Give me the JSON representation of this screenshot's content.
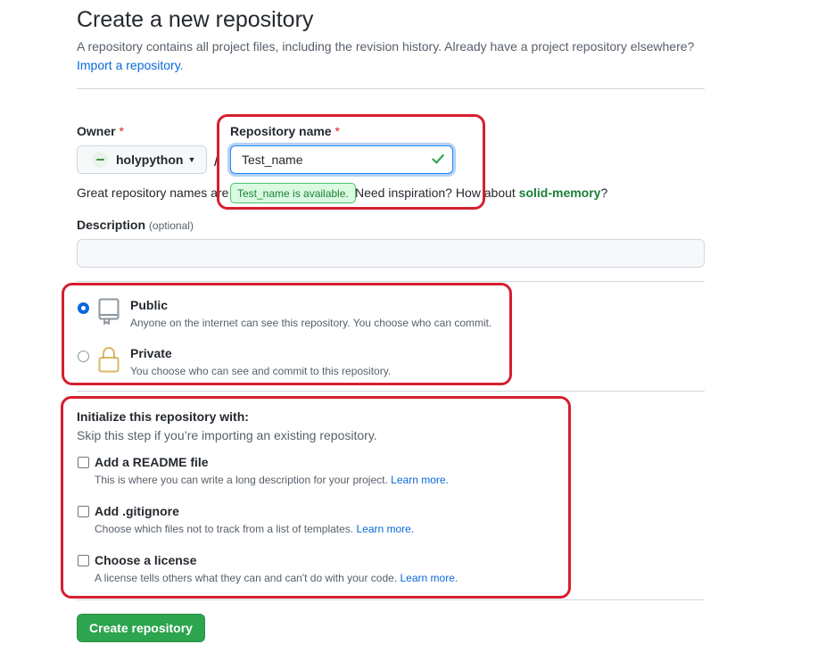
{
  "header": {
    "title": "Create a new repository",
    "subtitle": "A repository contains all project files, including the revision history. Already have a project repository elsewhere?",
    "import_link": "Import a repository."
  },
  "owner": {
    "label": "Owner",
    "required_mark": "*",
    "value": "holypython",
    "separator": "/"
  },
  "repo_name": {
    "label": "Repository name",
    "required_mark": "*",
    "value": "Test_name",
    "availability": "Test_name is available."
  },
  "naming_hint": {
    "prefix": "Great repository names are",
    "inspiration": "Need inspiration? How about",
    "suggestion": "solid-memory",
    "suffix": "?"
  },
  "description": {
    "label": "Description",
    "optional": "(optional)",
    "value": ""
  },
  "visibility": {
    "options": [
      {
        "title": "Public",
        "desc": "Anyone on the internet can see this repository. You choose who can commit.",
        "selected": true
      },
      {
        "title": "Private",
        "desc": "You choose who can see and commit to this repository.",
        "selected": false
      }
    ]
  },
  "initialize": {
    "title": "Initialize this repository with:",
    "subtitle": "Skip this step if you’re importing an existing repository.",
    "options": [
      {
        "title": "Add a README file",
        "desc": "This is where you can write a long description for your project.",
        "link": "Learn more."
      },
      {
        "title": "Add .gitignore",
        "desc": "Choose which files not to track from a list of templates.",
        "link": "Learn more."
      },
      {
        "title": "Choose a license",
        "desc": "A license tells others what they can and can't do with your code.",
        "link": "Learn more."
      }
    ]
  },
  "actions": {
    "create_label": "Create repository"
  },
  "colors": {
    "accent_blue": "#0969da",
    "success_green": "#2da44e",
    "highlight_red": "#d51f2f"
  }
}
